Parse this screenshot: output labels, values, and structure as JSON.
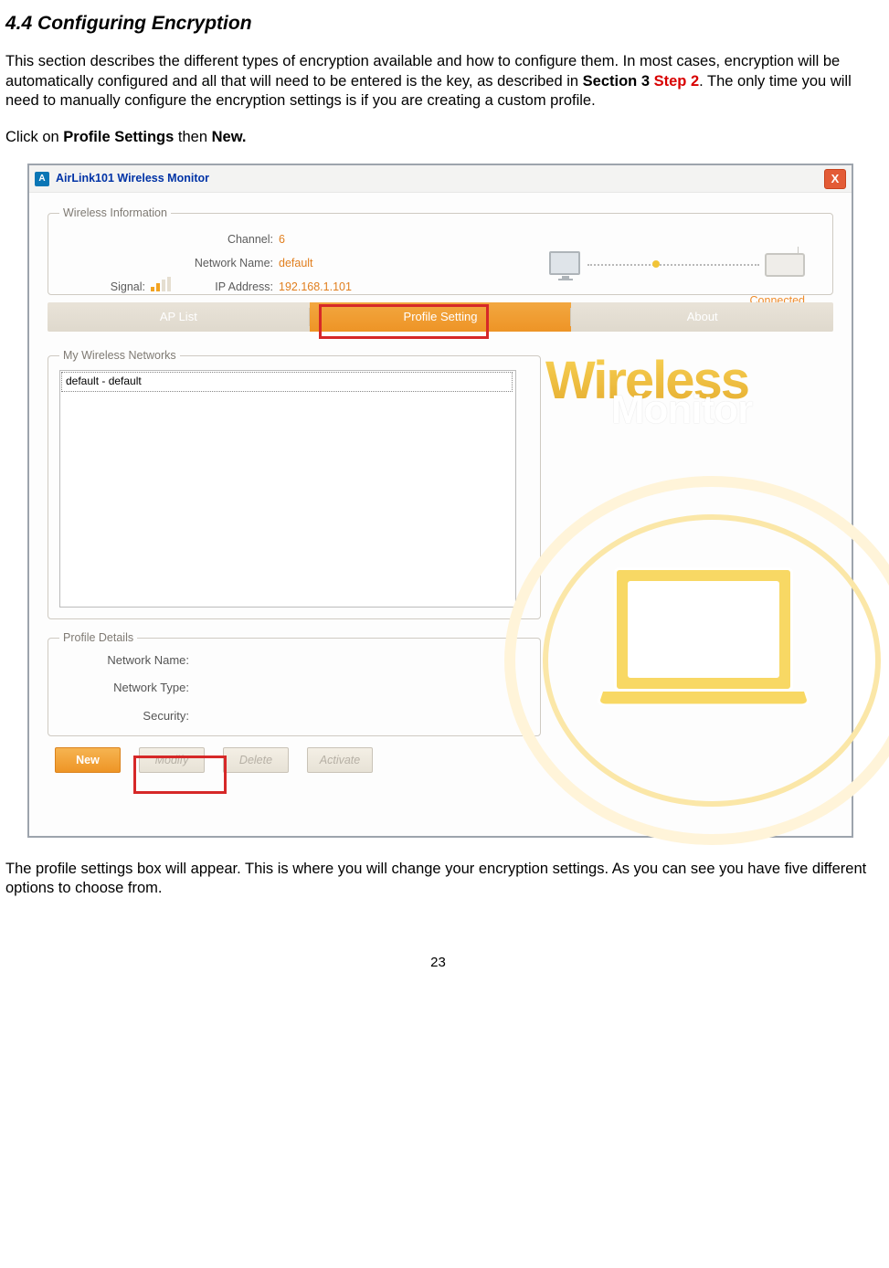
{
  "section": {
    "number": "4.4",
    "title": "Configuring Encryption"
  },
  "paragraph1_a": "This section describes the different types of encryption available and how to configure them.  In most cases, encryption will be automatically configured and all that will need to be entered is the key, as described in ",
  "paragraph1_b": "Section 3 ",
  "paragraph1_c": "Step 2",
  "paragraph1_d": ".  The only time you will need to manually configure the encryption settings is if you are creating a custom profile.",
  "paragraph2_a": "Click on ",
  "paragraph2_b": "Profile Settings",
  "paragraph2_c": " then ",
  "paragraph2_d": "New.",
  "paragraph3": "The profile settings box will appear.  This is where you will change your encryption settings.  As you can see you have five different options to choose from.",
  "window": {
    "title": "AirLink101 Wireless Monitor",
    "close_glyph": "X",
    "info_group": "Wireless Information",
    "signal_label": "Signal:",
    "channel_label": "Channel:",
    "channel_value": "6",
    "netname_label": "Network Name:",
    "netname_value": "default",
    "ip_label": "IP Address:",
    "ip_value": "192.168.1.101",
    "connected": "Connected",
    "tabs": {
      "ap": "AP List",
      "profile": "Profile Setting",
      "about": "About"
    },
    "mwn_group": "My Wireless Networks",
    "list_entry": "default - default",
    "pd_group": "Profile Details",
    "pd_netname": "Network Name:",
    "pd_nettype": "Network Type:",
    "pd_security": "Security:",
    "btn_new": "New",
    "btn_modify": "Modify",
    "btn_delete": "Delete",
    "btn_activate": "Activate",
    "brand_w": "Wireless",
    "brand_m": "Monitor"
  },
  "page_number": "23"
}
